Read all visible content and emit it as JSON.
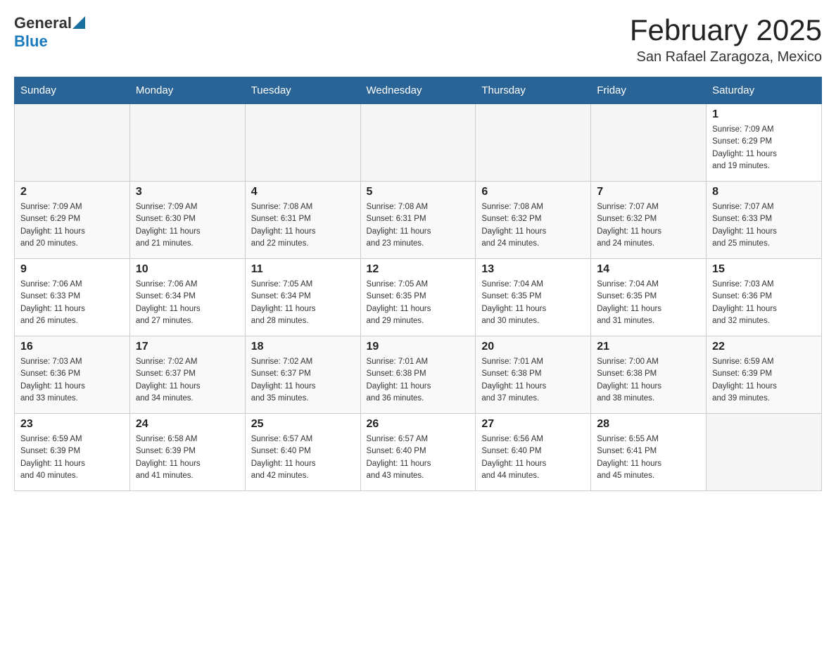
{
  "header": {
    "logo_general": "General",
    "logo_blue": "Blue",
    "month_title": "February 2025",
    "location": "San Rafael Zaragoza, Mexico"
  },
  "days_of_week": [
    "Sunday",
    "Monday",
    "Tuesday",
    "Wednesday",
    "Thursday",
    "Friday",
    "Saturday"
  ],
  "weeks": [
    {
      "days": [
        {
          "number": "",
          "info": ""
        },
        {
          "number": "",
          "info": ""
        },
        {
          "number": "",
          "info": ""
        },
        {
          "number": "",
          "info": ""
        },
        {
          "number": "",
          "info": ""
        },
        {
          "number": "",
          "info": ""
        },
        {
          "number": "1",
          "info": "Sunrise: 7:09 AM\nSunset: 6:29 PM\nDaylight: 11 hours\nand 19 minutes."
        }
      ]
    },
    {
      "days": [
        {
          "number": "2",
          "info": "Sunrise: 7:09 AM\nSunset: 6:29 PM\nDaylight: 11 hours\nand 20 minutes."
        },
        {
          "number": "3",
          "info": "Sunrise: 7:09 AM\nSunset: 6:30 PM\nDaylight: 11 hours\nand 21 minutes."
        },
        {
          "number": "4",
          "info": "Sunrise: 7:08 AM\nSunset: 6:31 PM\nDaylight: 11 hours\nand 22 minutes."
        },
        {
          "number": "5",
          "info": "Sunrise: 7:08 AM\nSunset: 6:31 PM\nDaylight: 11 hours\nand 23 minutes."
        },
        {
          "number": "6",
          "info": "Sunrise: 7:08 AM\nSunset: 6:32 PM\nDaylight: 11 hours\nand 24 minutes."
        },
        {
          "number": "7",
          "info": "Sunrise: 7:07 AM\nSunset: 6:32 PM\nDaylight: 11 hours\nand 24 minutes."
        },
        {
          "number": "8",
          "info": "Sunrise: 7:07 AM\nSunset: 6:33 PM\nDaylight: 11 hours\nand 25 minutes."
        }
      ]
    },
    {
      "days": [
        {
          "number": "9",
          "info": "Sunrise: 7:06 AM\nSunset: 6:33 PM\nDaylight: 11 hours\nand 26 minutes."
        },
        {
          "number": "10",
          "info": "Sunrise: 7:06 AM\nSunset: 6:34 PM\nDaylight: 11 hours\nand 27 minutes."
        },
        {
          "number": "11",
          "info": "Sunrise: 7:05 AM\nSunset: 6:34 PM\nDaylight: 11 hours\nand 28 minutes."
        },
        {
          "number": "12",
          "info": "Sunrise: 7:05 AM\nSunset: 6:35 PM\nDaylight: 11 hours\nand 29 minutes."
        },
        {
          "number": "13",
          "info": "Sunrise: 7:04 AM\nSunset: 6:35 PM\nDaylight: 11 hours\nand 30 minutes."
        },
        {
          "number": "14",
          "info": "Sunrise: 7:04 AM\nSunset: 6:35 PM\nDaylight: 11 hours\nand 31 minutes."
        },
        {
          "number": "15",
          "info": "Sunrise: 7:03 AM\nSunset: 6:36 PM\nDaylight: 11 hours\nand 32 minutes."
        }
      ]
    },
    {
      "days": [
        {
          "number": "16",
          "info": "Sunrise: 7:03 AM\nSunset: 6:36 PM\nDaylight: 11 hours\nand 33 minutes."
        },
        {
          "number": "17",
          "info": "Sunrise: 7:02 AM\nSunset: 6:37 PM\nDaylight: 11 hours\nand 34 minutes."
        },
        {
          "number": "18",
          "info": "Sunrise: 7:02 AM\nSunset: 6:37 PM\nDaylight: 11 hours\nand 35 minutes."
        },
        {
          "number": "19",
          "info": "Sunrise: 7:01 AM\nSunset: 6:38 PM\nDaylight: 11 hours\nand 36 minutes."
        },
        {
          "number": "20",
          "info": "Sunrise: 7:01 AM\nSunset: 6:38 PM\nDaylight: 11 hours\nand 37 minutes."
        },
        {
          "number": "21",
          "info": "Sunrise: 7:00 AM\nSunset: 6:38 PM\nDaylight: 11 hours\nand 38 minutes."
        },
        {
          "number": "22",
          "info": "Sunrise: 6:59 AM\nSunset: 6:39 PM\nDaylight: 11 hours\nand 39 minutes."
        }
      ]
    },
    {
      "days": [
        {
          "number": "23",
          "info": "Sunrise: 6:59 AM\nSunset: 6:39 PM\nDaylight: 11 hours\nand 40 minutes."
        },
        {
          "number": "24",
          "info": "Sunrise: 6:58 AM\nSunset: 6:39 PM\nDaylight: 11 hours\nand 41 minutes."
        },
        {
          "number": "25",
          "info": "Sunrise: 6:57 AM\nSunset: 6:40 PM\nDaylight: 11 hours\nand 42 minutes."
        },
        {
          "number": "26",
          "info": "Sunrise: 6:57 AM\nSunset: 6:40 PM\nDaylight: 11 hours\nand 43 minutes."
        },
        {
          "number": "27",
          "info": "Sunrise: 6:56 AM\nSunset: 6:40 PM\nDaylight: 11 hours\nand 44 minutes."
        },
        {
          "number": "28",
          "info": "Sunrise: 6:55 AM\nSunset: 6:41 PM\nDaylight: 11 hours\nand 45 minutes."
        },
        {
          "number": "",
          "info": ""
        }
      ]
    }
  ]
}
